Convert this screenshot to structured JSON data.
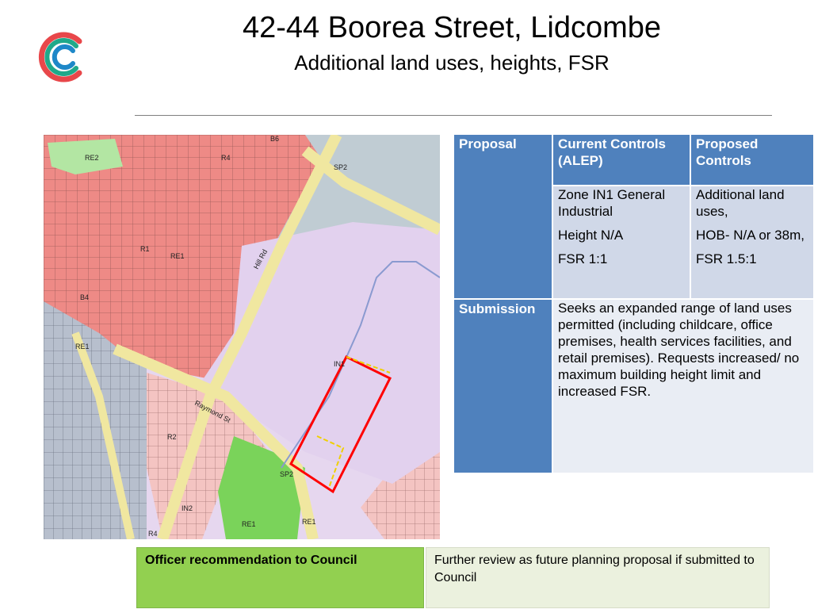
{
  "title": "42-44 Boorea Street, Lidcombe",
  "subtitle": "Additional land uses, heights, FSR",
  "map": {
    "labels": {
      "re2": "RE2",
      "b6": "B6",
      "sp2_top": "SP2",
      "r4_top": "R4",
      "r1": "R1",
      "re1_mid": "RE1",
      "b4": "B4",
      "re1_left": "RE1",
      "in1": "IN1",
      "r2": "R2",
      "sp2_bottom": "SP2",
      "in2": "IN2",
      "re1_bottom": "RE1",
      "r4_bottom": "R4",
      "re1_right": "RE1",
      "street_1": "Raymond St",
      "street_2": "Hill Rd"
    }
  },
  "table": {
    "headers": [
      "Proposal",
      "Current Controls (ALEP)",
      "Proposed Controls"
    ],
    "current": [
      "Zone IN1 General Industrial",
      "Height N/A",
      "FSR 1:1"
    ],
    "proposed": [
      "Additional land uses,",
      "HOB- N/A or 38m,",
      "FSR 1.5:1"
    ],
    "submission_label": "Submission",
    "submission_text": "Seeks an expanded range of land uses permitted (including childcare, office premises, health services facilities, and retail premises). Requests increased/ no maximum building height limit and increased FSR."
  },
  "recommendation": {
    "label": "Officer recommendation to Council",
    "text": "Further review as future planning proposal if submitted to Council"
  },
  "colors": {
    "header_blue": "#4f81bd",
    "light_cell": "#d0d8e8",
    "green": "#92d050",
    "zone_residential_red": "#f08080",
    "zone_industrial_purple": "#e3d4ee",
    "zone_grey_blue": "#b4bfcf",
    "zone_green": "#7ad35a",
    "site_outline": "#ff0000"
  }
}
